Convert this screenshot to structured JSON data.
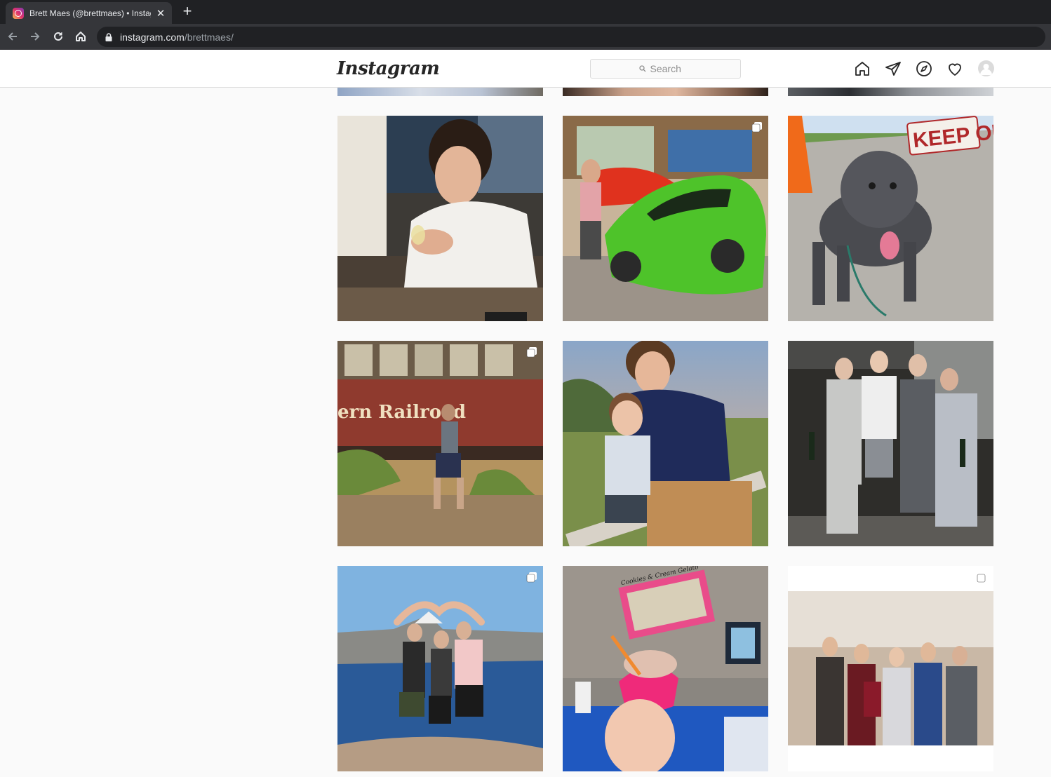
{
  "browser": {
    "tab_title": "Brett Maes (@brettmaes) • Instagram photos and videos",
    "new_tab_label": "+",
    "close_label": "✕",
    "url_host": "instagram.com",
    "url_path": "/brettmaes/"
  },
  "instagram": {
    "logo_text": "Instagram",
    "search_placeholder": "Search",
    "nav_icons": [
      "home-icon",
      "direct-icon",
      "explore-icon",
      "activity-icon",
      "profile-avatar"
    ]
  },
  "posts": [
    {
      "name": "post-partial-1",
      "description": "cropped top row image 1",
      "multi": false
    },
    {
      "name": "post-partial-2",
      "description": "cropped top row image 2",
      "multi": false
    },
    {
      "name": "post-partial-3",
      "description": "cropped top row image 3",
      "multi": false
    },
    {
      "name": "post-restaurant-drink",
      "description": "man with drink at restaurant",
      "multi": false
    },
    {
      "name": "post-green-car",
      "description": "man with green sports car",
      "multi": true
    },
    {
      "name": "post-dog-keep-out",
      "description": "dog with keep out sign",
      "multi": false
    },
    {
      "name": "post-railroad",
      "description": "man posing by railroad car",
      "multi": true,
      "sign_text": "ern Railroad"
    },
    {
      "name": "post-sunset-kid",
      "description": "man with child at sunset",
      "multi": false
    },
    {
      "name": "post-suits-group",
      "description": "group in suits with bottles",
      "multi": false
    },
    {
      "name": "post-crater-lake",
      "description": "three friends heart pose at lake",
      "multi": true
    },
    {
      "name": "post-ice-cream",
      "description": "hand holding ice cream cup",
      "multi": false,
      "sign_text": "Cookies & Cream Gelato"
    },
    {
      "name": "post-family-group",
      "description": "family group photo indoors",
      "multi": true
    }
  ],
  "colors": {
    "ig_border": "#dbdbdb",
    "ig_bg": "#fafafa",
    "chrome_dark": "#202124",
    "chrome_toolbar": "#35363a"
  }
}
